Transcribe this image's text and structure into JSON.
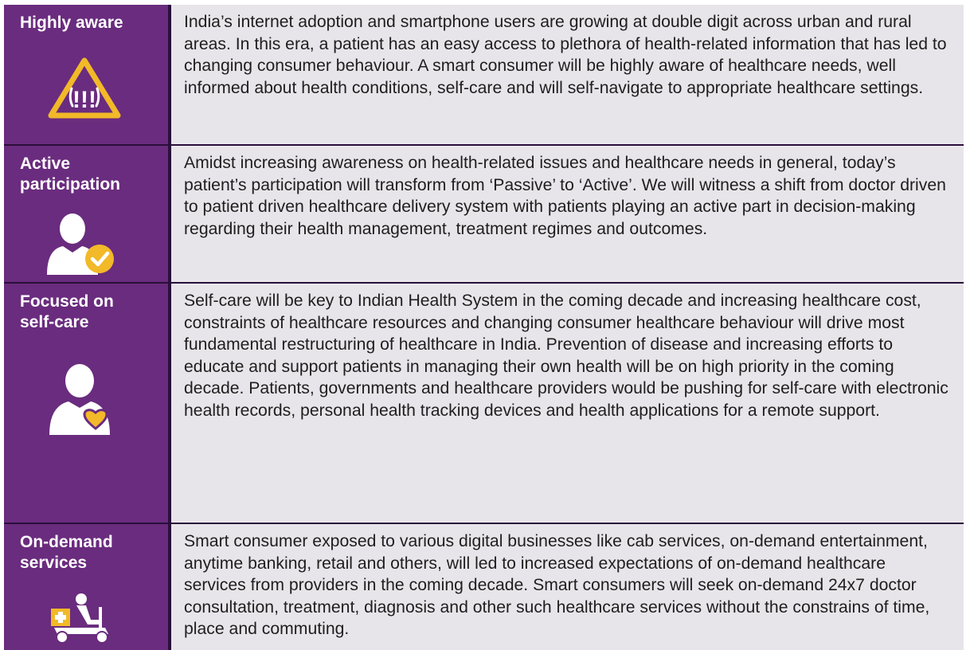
{
  "rows": [
    {
      "label": "Highly aware",
      "icon": "warning-icon",
      "text": "India’s internet adoption and smartphone users are growing at double digit across urban and rural areas. In this era, a patient has an easy access to plethora of health-related information that has led to changing consumer behaviour. A smart consumer will be highly aware of healthcare needs, well informed about health conditions, self-care and will self-navigate to appropriate healthcare settings."
    },
    {
      "label": "Active\nparticipation",
      "icon": "person-check-icon",
      "text": "Amidst increasing awareness on health-related issues and healthcare needs in general, today’s patient’s participation will transform from ‘Passive’ to ‘Active’. We will witness a shift from doctor driven  to patient driven healthcare delivery system with patients playing an active part in decision-making regarding their health management, treatment regimes and outcomes."
    },
    {
      "label": "Focused on\nself-care",
      "icon": "person-heart-icon",
      "text": "Self-care will be key to Indian Health System in the coming decade and increasing healthcare cost, constraints of healthcare resources and changing consumer healthcare behaviour will drive most fundamental restructuring of healthcare in India. Prevention of disease and increasing efforts to educate and support patients in managing their own health will be on high priority in the coming decade. Patients, governments and healthcare providers would be pushing for self-care with electronic health records, personal health tracking devices and health applications for a remote support."
    },
    {
      "label": "On-demand\nservices",
      "icon": "scooter-delivery-icon",
      "text": "Smart consumer exposed to various digital businesses like cab services, on-demand entertainment, anytime banking, retail and others, will led to increased expectations of on-demand healthcare services from providers in the coming decade. Smart consumers will seek on-demand 24x7 doctor consultation, treatment, diagnosis and other such healthcare services without the constrains of time, place and commuting."
    }
  ],
  "colors": {
    "label_bg": "#6a2c7e",
    "text_bg": "#e8e5ea",
    "accent": "#f2b928",
    "divider": "#2a0f3a"
  }
}
